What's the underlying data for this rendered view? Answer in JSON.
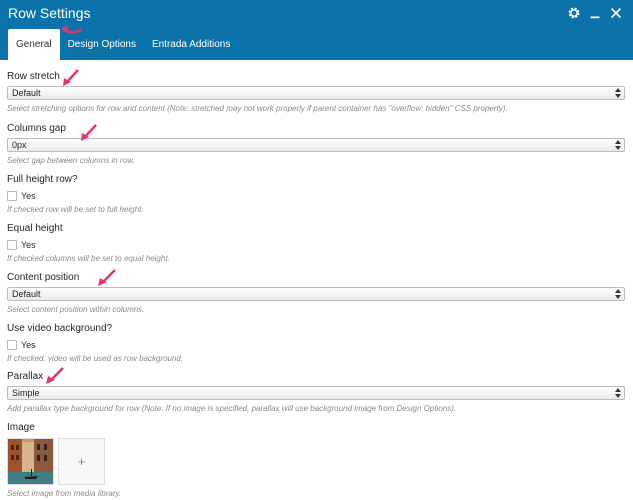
{
  "window": {
    "title": "Row Settings",
    "icons": [
      "gear-icon",
      "minimize-icon",
      "close-icon"
    ]
  },
  "tabs": [
    {
      "label": "General",
      "active": true
    },
    {
      "label": "Design Options",
      "active": false
    },
    {
      "label": "Entrada Additions",
      "active": false
    }
  ],
  "fields": {
    "row_stretch": {
      "label": "Row stretch",
      "value": "Default",
      "desc": "Select stretching options for row and content (Note: stretched may not work properly if parent container has \"overflow: hidden\" CSS property)."
    },
    "columns_gap": {
      "label": "Columns gap",
      "value": "0px",
      "desc": "Select gap between columns in row."
    },
    "full_height": {
      "label": "Full height row?",
      "check_label": "Yes",
      "checked": false,
      "desc": "If checked row will be set to full height."
    },
    "equal_height": {
      "label": "Equal height",
      "check_label": "Yes",
      "checked": false,
      "desc": "If checked columns will be set to equal height."
    },
    "content_position": {
      "label": "Content position",
      "value": "Default",
      "desc": "Select content position within columns."
    },
    "video_bg": {
      "label": "Use video background?",
      "check_label": "Yes",
      "checked": false,
      "desc": "If checked, video will be used as row background."
    },
    "parallax": {
      "label": "Parallax",
      "value": "Simple",
      "desc": "Add parallax type background for row (Note: If no image is specified, parallax will use background image from Design Options)."
    },
    "image": {
      "label": "Image",
      "add_symbol": "+",
      "desc": "Select image from media library."
    }
  },
  "colors": {
    "header": "#0b73aa",
    "annotation_arrow": "#e8336d",
    "add_plus": "#4caf50"
  }
}
